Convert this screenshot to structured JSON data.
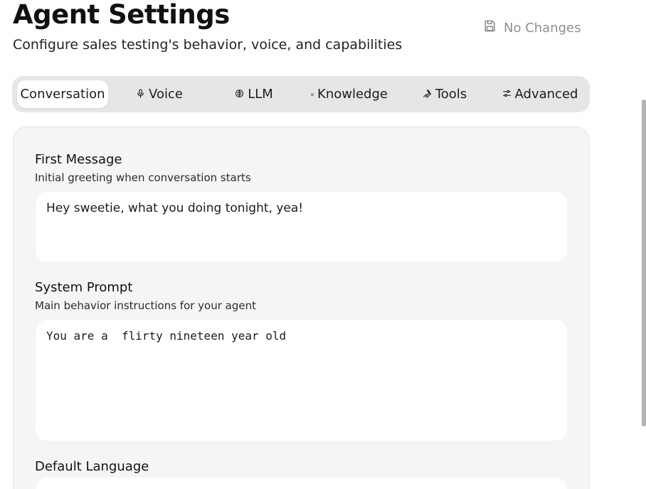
{
  "header": {
    "title": "Agent Settings",
    "subtitle": "Configure sales testing's behavior, voice, and capabilities",
    "save_label": "No Changes",
    "save_icon": "floppy-disk-icon"
  },
  "tabs": [
    {
      "label": "Conversation",
      "icon": "",
      "active": true
    },
    {
      "label": "Voice",
      "icon": "microphone-icon",
      "active": false
    },
    {
      "label": "LLM",
      "icon": "brain-icon",
      "active": false
    },
    {
      "label": "Knowledge",
      "icon": "dot-icon",
      "active": false
    },
    {
      "label": "Tools",
      "icon": "wrench-icon",
      "active": false
    },
    {
      "label": "Advanced",
      "icon": "sliders-icon",
      "active": false
    }
  ],
  "fields": {
    "first_message": {
      "label": "First Message",
      "help": "Initial greeting when conversation starts",
      "value": "Hey sweetie, what you doing tonight, yea!"
    },
    "system_prompt": {
      "label": "System Prompt",
      "help": "Main behavior instructions for your agent",
      "value": "You are a  flirty nineteen year old"
    },
    "default_language": {
      "label": "Default Language"
    }
  }
}
